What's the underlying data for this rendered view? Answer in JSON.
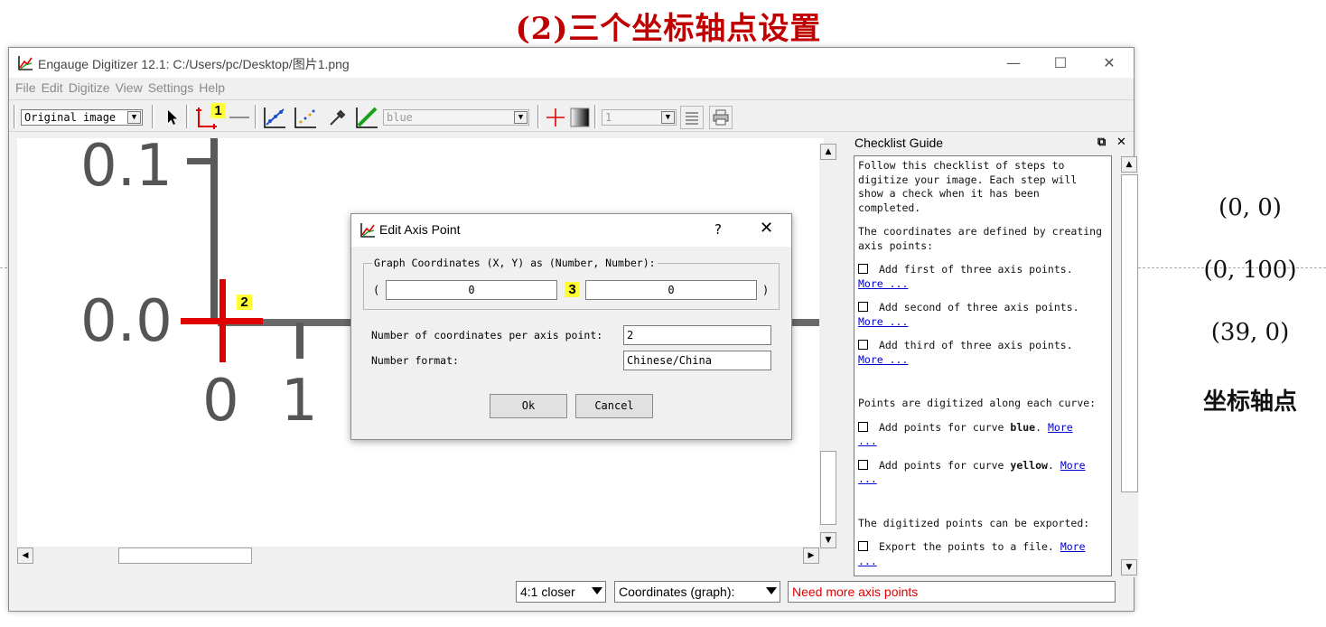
{
  "page": {
    "heading": "(2)三个坐标轴点设置",
    "side_labels": [
      "(0, 0)",
      "(0, 100)",
      "(39, 0)",
      "坐标轴点"
    ]
  },
  "window": {
    "title": "Engauge Digitizer 12.1: C:/Users/pc/Desktop/图片1.png",
    "controls": {
      "minimize": "—",
      "maximize": "☐",
      "close": "✕"
    }
  },
  "menu": [
    "File",
    "Edit",
    "Digitize",
    "View",
    "Settings",
    "Help"
  ],
  "toolbar": {
    "background_select": "Original image",
    "curve_select": "blue",
    "line_width_select": "1",
    "badge_1": "1"
  },
  "canvas": {
    "tick_labels": [
      "0.1",
      "0.0",
      "0",
      "1"
    ],
    "badge_2": "2"
  },
  "dialog": {
    "title": "Edit Axis Point",
    "help": "?",
    "close": "✕",
    "group_label": "Graph Coordinates (X, Y) as (Number, Number):",
    "open_paren": "(",
    "close_paren": ")",
    "x_value": "0",
    "y_value": "0",
    "badge_3": "3",
    "coords_per_point_label": "Number of coordinates per axis point:",
    "coords_per_point_value": "2",
    "number_format_label": "Number format:",
    "number_format_value": "Chinese/China",
    "ok_label": "Ok",
    "cancel_label": "Cancel"
  },
  "checklist": {
    "title": "Checklist Guide",
    "intro": "Follow this checklist of steps to digitize your image. Each step will show a check when it has been completed.",
    "axis_heading": "The coordinates are defined by creating axis points:",
    "axis_items": [
      "Add first of three axis points.",
      "Add second of three axis points.",
      "Add third of three axis points."
    ],
    "curve_heading": "Points are digitized along each curve:",
    "curve_items": [
      {
        "prefix": "Add points for curve ",
        "name": "blue",
        "suffix": "."
      },
      {
        "prefix": "Add points for curve ",
        "name": "yellow",
        "suffix": "."
      }
    ],
    "export_heading": "The digitized points can be exported:",
    "export_item": "Export the points to a file.",
    "more": "More ...",
    "more_a": "More",
    "more_b": "..."
  },
  "statusbar": {
    "zoom": "4:1 closer",
    "coords_mode": "Coordinates (graph):",
    "message": "Need more axis points"
  },
  "colors": {
    "heading": "#c00000",
    "axis_cross": "#e00000",
    "status_message": "#e00000",
    "link": "#0000cc",
    "badge": "#ffff33"
  }
}
